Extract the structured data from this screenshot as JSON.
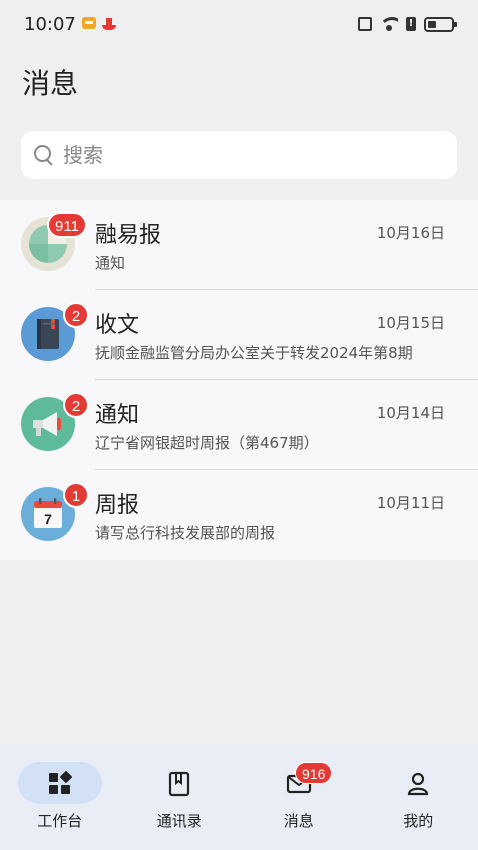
{
  "status_bar": {
    "time": "10:07"
  },
  "header": {
    "title": "消息"
  },
  "search": {
    "placeholder": "搜索"
  },
  "messages": [
    {
      "title": "融易报",
      "date": "10月16日",
      "subtitle": "通知",
      "badge": "911",
      "icon": "chart-icon",
      "color": "#e6e2d6"
    },
    {
      "title": "收文",
      "date": "10月15日",
      "subtitle": "抚顺金融监管分局办公室关于转发2024年第8期",
      "badge": "2",
      "icon": "notebook-icon",
      "color": "#5b9bd5"
    },
    {
      "title": "通知",
      "date": "10月14日",
      "subtitle": "辽宁省网银超时周报（第467期）",
      "badge": "2",
      "icon": "megaphone-icon",
      "color": "#5dbb9a"
    },
    {
      "title": "周报",
      "date": "10月11日",
      "subtitle": "请写总行科技发展部的周报",
      "badge": "1",
      "icon": "calendar-icon",
      "color": "#6aaed9"
    }
  ],
  "calendar_icon_day": "7",
  "bottom_nav": [
    {
      "label": "工作台",
      "icon": "grid-icon",
      "active": true
    },
    {
      "label": "通讯录",
      "icon": "book-icon",
      "active": false
    },
    {
      "label": "消息",
      "icon": "mail-icon",
      "active": false,
      "badge": "916"
    },
    {
      "label": "我的",
      "icon": "person-icon",
      "active": false
    }
  ],
  "colors": {
    "badge": "#e53935",
    "nav_active_pill": "#d3e1f7",
    "nav_bg": "#e9eef6"
  }
}
